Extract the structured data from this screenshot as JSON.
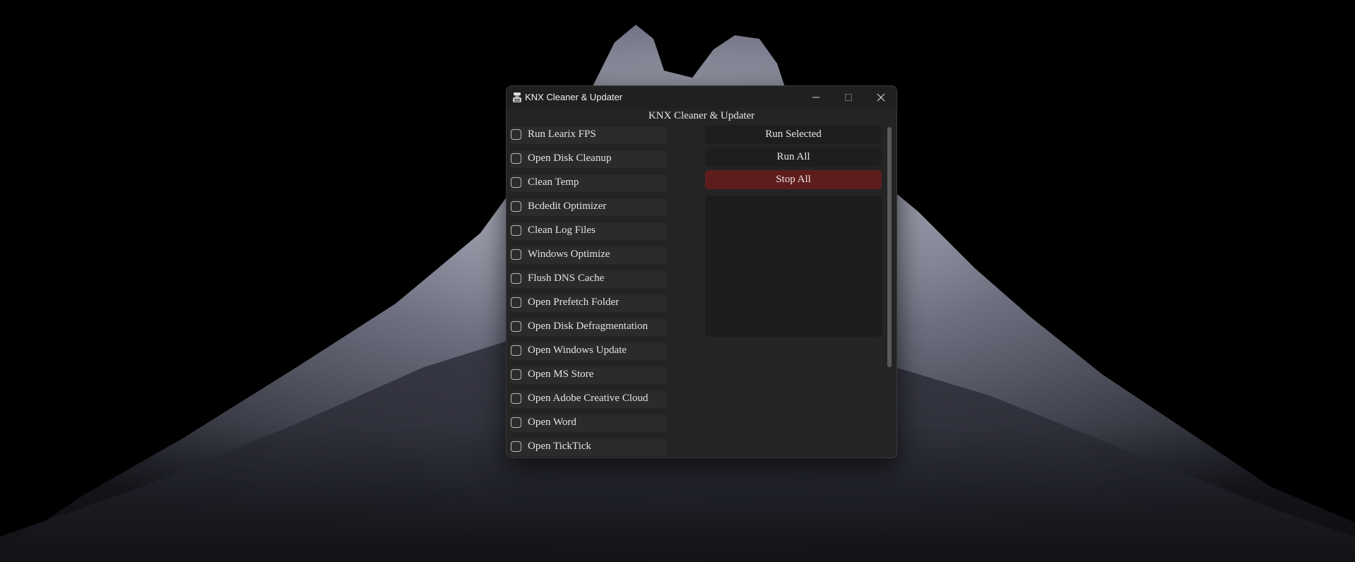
{
  "window": {
    "title": "KNX Cleaner & Updater",
    "header": "KNX Cleaner & Updater"
  },
  "tasks": [
    {
      "label": "Run Learix FPS",
      "checked": false
    },
    {
      "label": "Open Disk Cleanup",
      "checked": false
    },
    {
      "label": "Clean Temp",
      "checked": false
    },
    {
      "label": "Bcdedit Optimizer",
      "checked": false
    },
    {
      "label": "Clean Log Files",
      "checked": false
    },
    {
      "label": "Windows Optimize",
      "checked": false
    },
    {
      "label": "Flush DNS Cache",
      "checked": false
    },
    {
      "label": "Open Prefetch Folder",
      "checked": false
    },
    {
      "label": "Open Disk Defragmentation",
      "checked": false
    },
    {
      "label": "Open Windows Update",
      "checked": false
    },
    {
      "label": "Open MS Store",
      "checked": false
    },
    {
      "label": "Open Adobe Creative Cloud",
      "checked": false
    },
    {
      "label": "Open Word",
      "checked": false
    },
    {
      "label": "Open TickTick",
      "checked": false
    }
  ],
  "actions": {
    "run_selected": "Run Selected",
    "run_all": "Run All",
    "stop_all": "Stop All"
  },
  "icons": {
    "app": "app-icon",
    "minimize": "minimize-icon",
    "maximize": "maximize-icon",
    "close": "close-icon"
  },
  "colors": {
    "window_bg": "#242424",
    "stop_button": "#5e1d1d",
    "button_bg": "#1e1e1e"
  }
}
